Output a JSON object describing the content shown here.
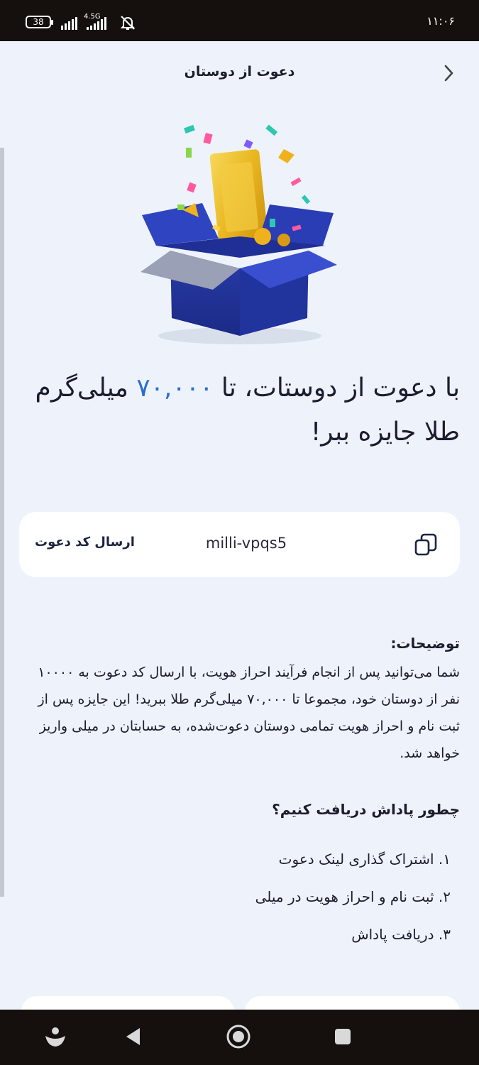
{
  "status_bar": {
    "battery": "38",
    "network": "4.5G",
    "time": "۱۱:۰۶"
  },
  "header": {
    "title": "دعوت از دوستان",
    "back_icon": "chevron-right-icon"
  },
  "headline": {
    "prefix": "با دعوت از دوستات، تا ",
    "amount": "۷۰,۰۰۰",
    "suffix": " میلی‌گرم طلا جایزه ببر!",
    "amount_color": "#2a6fce"
  },
  "invite": {
    "code": "milli-vpqs5",
    "send_label": "ارسال کد دعوت",
    "copy_icon": "copy-icon"
  },
  "description": {
    "title": "توضیحات:",
    "body": "شما می‌توانید پس از انجام فرآیند احراز هویت، با ارسال کد دعوت به ۱۰۰۰۰ نفر از دوستان خود، مجموعا تا ۷۰,۰۰۰ میلی‌گرم طلا ببرید! این جایزه پس از ثبت نام و احراز هویت تمامی دوستان دعوت‌شده، به حسابتان در میلی واریز خواهد شد."
  },
  "howto": {
    "title": "چطور پاداش دریافت کنیم؟",
    "steps": [
      "۱. اشتراک گذاری لینک دعوت",
      "۲. ثبت نام و احراز هویت در میلی",
      "۳. دریافت پاداش"
    ]
  },
  "nav": {
    "icons": [
      "assistant-icon",
      "back-icon",
      "home-icon",
      "recents-icon"
    ]
  }
}
